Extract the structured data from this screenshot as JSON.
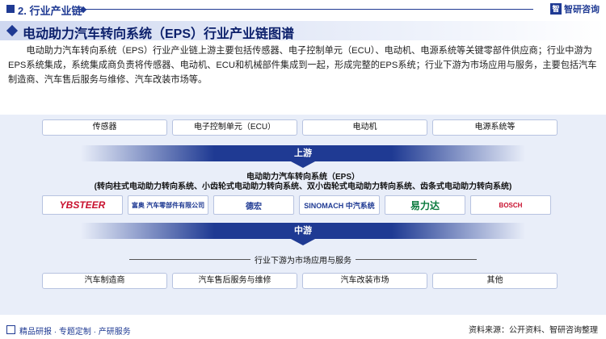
{
  "header": {
    "section": "2. 行业产业链",
    "brand": "智研咨询",
    "brand_logo": "智"
  },
  "title": "电动助力汽车转向系统（EPS）行业产业链图谱",
  "intro": "电动助力汽车转向系统（EPS）行业产业链上游主要包括传感器、电子控制单元（ECU）、电动机、电源系统等关键零部件供应商；行业中游为EPS系统集成，系统集成商负责将传感器、电动机、ECU和机械部件集成到一起，形成完整的EPS系统；行业下游为市场应用与服务，主要包括汽车制造商、汽车售后服务与维修、汽车改装市场等。",
  "upstream": {
    "items": [
      "传感器",
      "电子控制单元（ECU）",
      "电动机",
      "电源系统等"
    ],
    "label": "上游"
  },
  "midstream": {
    "title": "电动助力汽车转向系统（EPS）",
    "subtitle": "(转向柱式电动助力转向系统、小齿轮式电动助力转向系统、双小齿轮式电动助力转向系统、齿条式电动助力转向系统)",
    "logos": [
      {
        "text": "YBSTEER",
        "color": "#c8102e"
      },
      {
        "text": "富奥 汽车零部件有限公司",
        "color": "#1f3a93"
      },
      {
        "text": "德宏",
        "color": "#1f3a93"
      },
      {
        "text": "SINOMACH 中汽系统",
        "color": "#1f3a93"
      },
      {
        "text": "易力达",
        "color": "#0a7a3e"
      },
      {
        "text": "BOSCH",
        "color": "#c8102e"
      }
    ],
    "label": "中游"
  },
  "downstream": {
    "title": "行业下游为市场应用与服务",
    "items": [
      "汽车制造商",
      "汽车售后服务与维修",
      "汽车改装市场",
      "其他"
    ]
  },
  "footer": {
    "slogan": "精品研报 · 专题定制 · 产研服务",
    "source": "资料来源：公开资料、智研咨询整理"
  }
}
